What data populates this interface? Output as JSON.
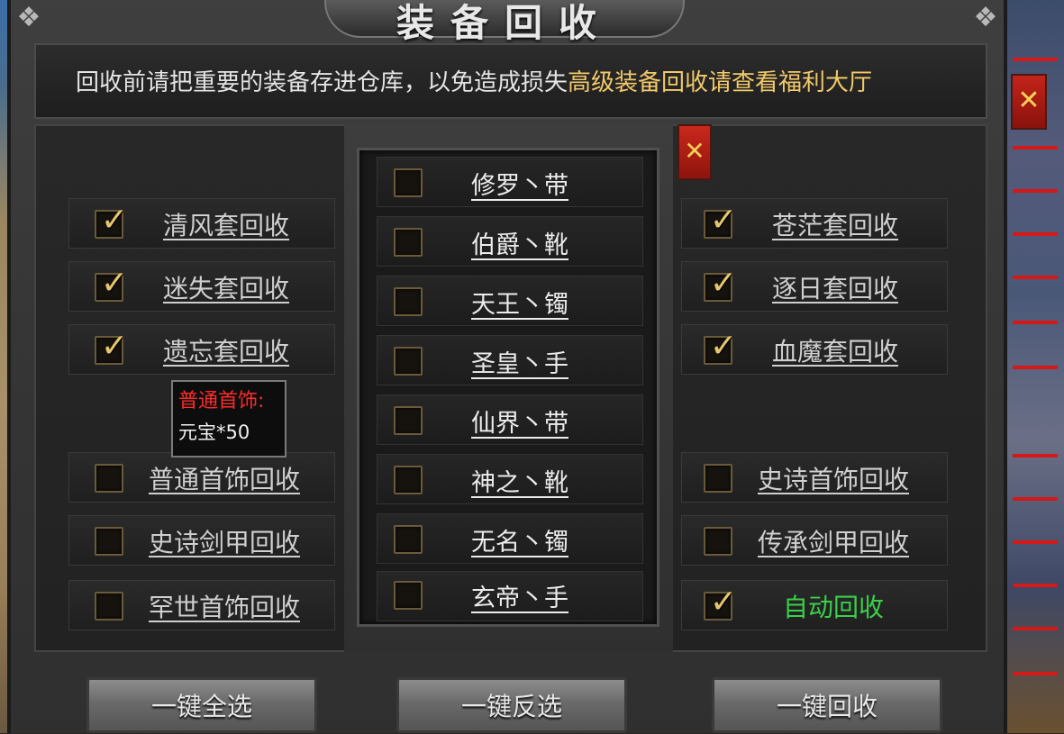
{
  "window": {
    "title": "装备回收",
    "notice_main": "回收前请把重要的装备存进仓库，以免造成损失",
    "notice_highlight": "高级装备回收请查看福利大厅"
  },
  "left_options": [
    {
      "label": "清风套回收",
      "checked": true
    },
    {
      "label": "迷失套回收",
      "checked": true
    },
    {
      "label": "遗忘套回收",
      "checked": true
    },
    {
      "label": "普通首饰回收",
      "checked": false
    },
    {
      "label": "史诗剑甲回收",
      "checked": false
    },
    {
      "label": "罕世首饰回收",
      "checked": false
    }
  ],
  "middle_options": [
    {
      "label": "修罗丶带",
      "checked": false
    },
    {
      "label": "伯爵丶靴",
      "checked": false
    },
    {
      "label": "天王丶镯",
      "checked": false
    },
    {
      "label": "圣皇丶手",
      "checked": false
    },
    {
      "label": "仙界丶带",
      "checked": false
    },
    {
      "label": "神之丶靴",
      "checked": false
    },
    {
      "label": "无名丶镯",
      "checked": false
    },
    {
      "label": "玄帝丶手",
      "checked": false
    }
  ],
  "right_options": [
    {
      "label": "苍茫套回收",
      "checked": true
    },
    {
      "label": "逐日套回收",
      "checked": true
    },
    {
      "label": "血魔套回收",
      "checked": true
    },
    {
      "label": "史诗首饰回收",
      "checked": false
    },
    {
      "label": "传承剑甲回收",
      "checked": false
    },
    {
      "label": "自动回收",
      "checked": true
    }
  ],
  "tooltip": {
    "title": "普通首饰:",
    "value": "元宝*50"
  },
  "buttons": {
    "select_all": "一键全选",
    "invert": "一键反选",
    "recycle": "一键回收"
  },
  "icons": {
    "close": "close-icon",
    "check": "checkmark-icon"
  },
  "colors": {
    "highlight_text": "#f2c96a",
    "auto_recycle": "#3ad04a",
    "tooltip_title": "#ff2a2a",
    "close_button": "#c2241a"
  }
}
